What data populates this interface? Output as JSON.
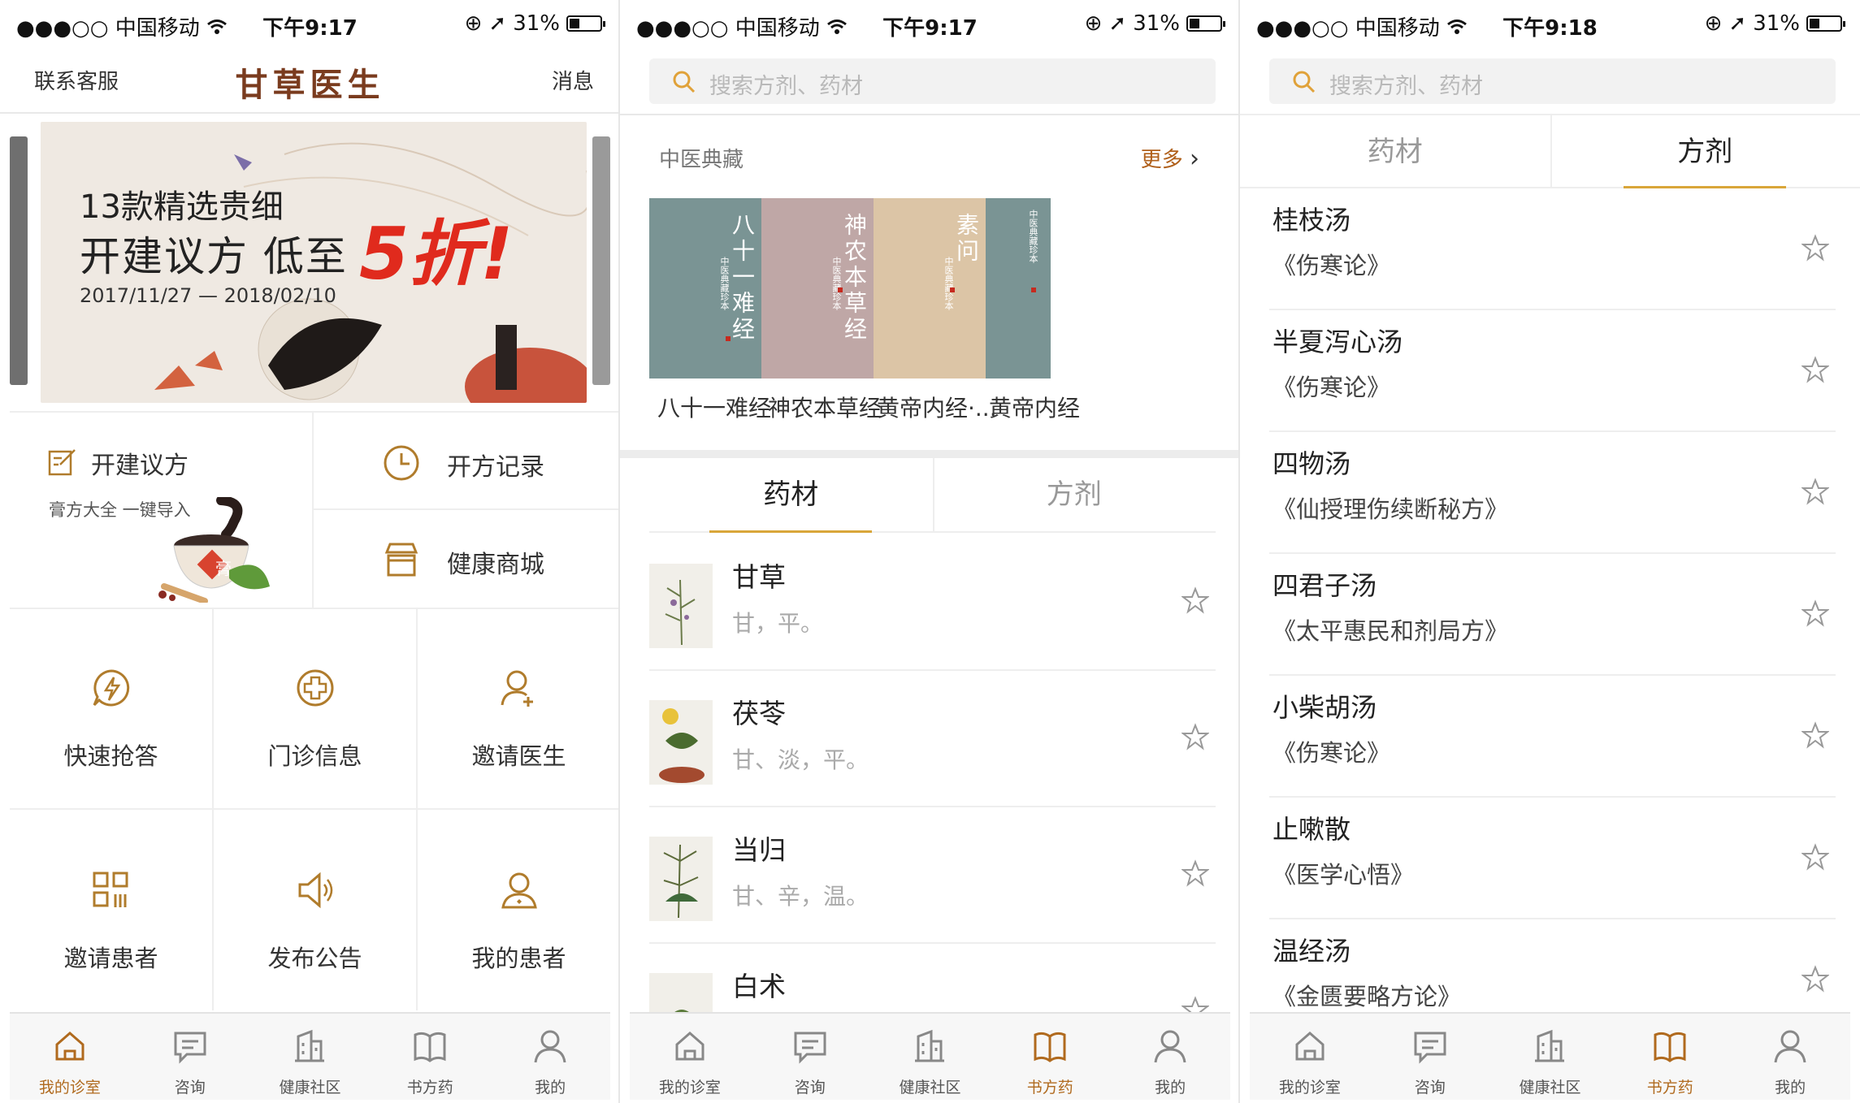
{
  "status_bars": [
    {
      "carrier": "●●●○○ 中国移动",
      "time": "下午9:17",
      "battery": "31%"
    },
    {
      "carrier": "●●●○○ 中国移动",
      "time": "下午9:17",
      "battery": "31%"
    },
    {
      "carrier": "●●●○○ 中国移动",
      "time": "下午9:18",
      "battery": "31%"
    }
  ],
  "home": {
    "nav": {
      "left": "联系客服",
      "title": "甘草医生",
      "right": "消息"
    },
    "banner": {
      "line1": "13款精选贵细",
      "line2": "开建议方 低至",
      "highlight": "5折!",
      "date": "2017/11/27 — 2018/02/10"
    },
    "quick": {
      "open_rx": "开建议方",
      "open_rx_sub": "膏方大全 一键导入",
      "badge": "膏",
      "rx_record": "开方记录",
      "shop": "健康商城"
    },
    "grid": [
      "快速抢答",
      "门诊信息",
      "邀请医生",
      "邀请患者",
      "发布公告",
      "我的患者"
    ]
  },
  "tabbar": [
    "我的诊室",
    "咨询",
    "健康社区",
    "书方药",
    "我的"
  ],
  "search_placeholder": "搜索方剂、药材",
  "library": {
    "section_title": "中医典藏",
    "more": "更多",
    "book_series": "中医典藏珍本",
    "books": [
      {
        "cover": "八十一难经",
        "label": "八十一难经",
        "color": "#7a9494"
      },
      {
        "cover": "神农本草经",
        "label": "神农本草经",
        "color": "#bfa7a6"
      },
      {
        "cover": "素问",
        "label": "黄帝内经·...",
        "color": "#dcc5a6"
      },
      {
        "cover": "",
        "label": "黄帝内经",
        "color": "#7a9494"
      }
    ]
  },
  "seg_tabs": [
    "药材",
    "方剂"
  ],
  "herbs": [
    {
      "name": "甘草",
      "prop": "甘，平。"
    },
    {
      "name": "茯苓",
      "prop": "甘、淡，平。"
    },
    {
      "name": "当归",
      "prop": "甘、辛，温。"
    },
    {
      "name": "白术",
      "prop": ""
    }
  ],
  "prescriptions": [
    {
      "name": "桂枝汤",
      "source": "《伤寒论》"
    },
    {
      "name": "半夏泻心汤",
      "source": "《伤寒论》"
    },
    {
      "name": "四物汤",
      "source": "《仙授理伤续断秘方》"
    },
    {
      "name": "四君子汤",
      "source": "《太平惠民和剂局方》"
    },
    {
      "name": "小柴胡汤",
      "source": "《伤寒论》"
    },
    {
      "name": "止嗽散",
      "source": "《医学心悟》"
    },
    {
      "name": "温经汤",
      "source": "《金匮要略方论》"
    }
  ],
  "colors": {
    "accent": "#b06a1e",
    "gold": "#b07c2c",
    "tab_underline": "#d9a63a"
  }
}
